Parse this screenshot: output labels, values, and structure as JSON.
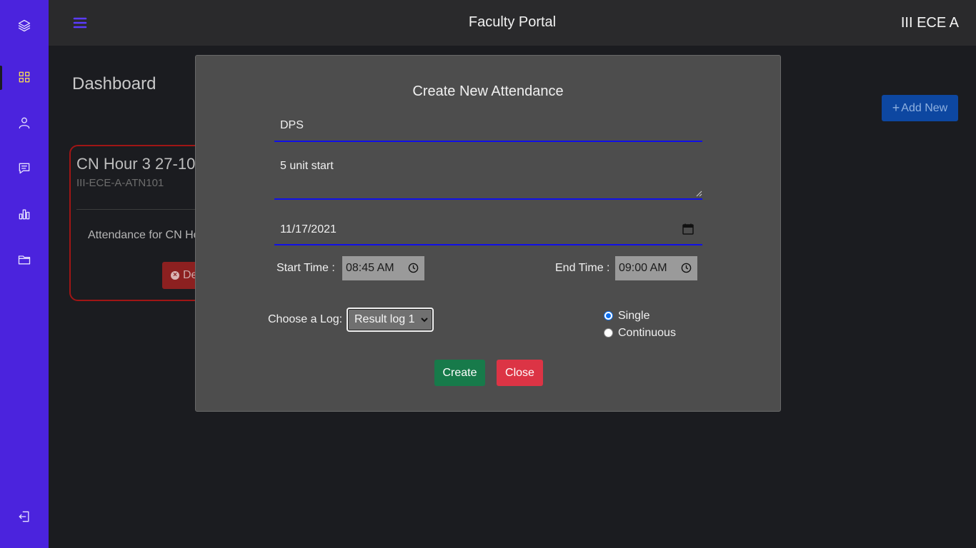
{
  "header": {
    "portal_title": "Faculty Portal",
    "class_label": "III ECE A",
    "menu_icon": "hamburger-icon"
  },
  "sidebar": {
    "items": [
      {
        "icon": "layers-icon",
        "active": false
      },
      {
        "icon": "grid-icon",
        "active": true
      },
      {
        "icon": "user-icon",
        "active": false
      },
      {
        "icon": "message-icon",
        "active": false
      },
      {
        "icon": "bar-chart-icon",
        "active": false
      },
      {
        "icon": "folder-icon",
        "active": false
      },
      {
        "icon": "logout-icon",
        "active": false
      }
    ],
    "accent_color": "#4b23dd",
    "active_color": "#f3d65a"
  },
  "page": {
    "title": "Dashboard",
    "add_new_label": "Add New"
  },
  "card": {
    "title": "CN Hour 3 27-10",
    "subtitle": "III-ECE-A-ATN101",
    "text": "Attendance for CN Ho",
    "delete_label": "De"
  },
  "modal": {
    "title": "Create New Attendance",
    "name_value": "DPS",
    "description_value": "5 unit start",
    "date_value": "11/17/2021",
    "start_time_label": "Start Time :",
    "start_time_value": "08:45 AM",
    "end_time_label": "End Time :",
    "end_time_value": "09:00 AM",
    "log_label": "Choose a Log:",
    "log_selected": "Result log 1",
    "mode_options": [
      {
        "label": "Single",
        "checked": true
      },
      {
        "label": "Continuous",
        "checked": false
      }
    ],
    "create_label": "Create",
    "close_label": "Close"
  },
  "colors": {
    "create": "#177a4a",
    "close": "#dc3445",
    "add_new": "#0d47a1",
    "field_underline": "#1010e8"
  }
}
